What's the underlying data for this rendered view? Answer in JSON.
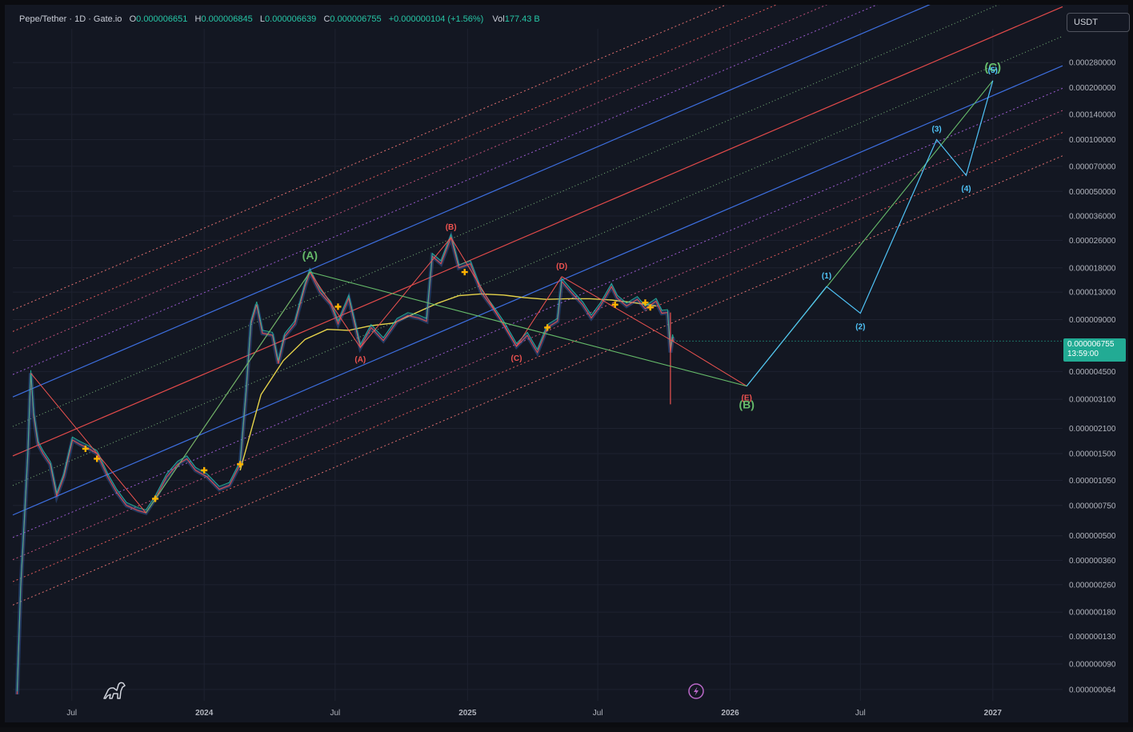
{
  "header": {
    "symbol": "Pepe/Tether · 1D · Gate.io",
    "open_key": "O",
    "open": "0.000006651",
    "high_key": "H",
    "high": "0.000006845",
    "low_key": "L",
    "low": "0.000006639",
    "close_key": "C",
    "close": "0.000006755",
    "change": "+0.000000104 (+1.56%)",
    "vol_key": "Vol",
    "vol": "177.43 B"
  },
  "currency_button": "USDT",
  "price_tag": {
    "price": "0.000006755",
    "countdown": "13:59:00"
  },
  "colors": {
    "background": "#131722",
    "grid": "#1e2230",
    "up": "#26c6a6",
    "down": "#ef5350",
    "channel_blue": "#3d6fe0",
    "channel_red": "#e34a4a",
    "wave_green": "#66bb6a",
    "wave_cyan": "#4fc3f7",
    "wave_red_label": "#ef5350",
    "ma_yellow": "#e6d34a"
  },
  "icons": {
    "logo": "dinosaur-icon",
    "alert": "lightning-icon"
  },
  "chart_data": {
    "type": "line",
    "title": "",
    "xlabel": "",
    "ylabel": "",
    "y_scale": "log",
    "ylim": [
      5.5e-08,
      0.00044
    ],
    "xlim": [
      "2023-04-10",
      "2027-04-08"
    ],
    "grid": true,
    "x_ticks": [
      {
        "date": "2023-07-01",
        "label": "Jul"
      },
      {
        "date": "2024-01-01",
        "label": "2024"
      },
      {
        "date": "2024-07-01",
        "label": "Jul"
      },
      {
        "date": "2025-01-01",
        "label": "2025"
      },
      {
        "date": "2025-07-01",
        "label": "Jul"
      },
      {
        "date": "2026-01-01",
        "label": "2026"
      },
      {
        "date": "2026-07-01",
        "label": "Jul"
      },
      {
        "date": "2027-01-01",
        "label": "2027"
      }
    ],
    "y_ticks": [
      {
        "value": 0.00028,
        "label": "0.000280000"
      },
      {
        "value": 0.0002,
        "label": "0.000200000"
      },
      {
        "value": 0.00014,
        "label": "0.000140000"
      },
      {
        "value": 0.0001,
        "label": "0.000100000"
      },
      {
        "value": 7e-05,
        "label": "0.000070000"
      },
      {
        "value": 5e-05,
        "label": "0.000050000"
      },
      {
        "value": 3.6e-05,
        "label": "0.000036000"
      },
      {
        "value": 2.6e-05,
        "label": "0.000026000"
      },
      {
        "value": 1.8e-05,
        "label": "0.000018000"
      },
      {
        "value": 1.3e-05,
        "label": "0.000013000"
      },
      {
        "value": 9e-06,
        "label": "0.000009000"
      },
      {
        "value": 4.5e-06,
        "label": "0.000004500"
      },
      {
        "value": 3.1e-06,
        "label": "0.000003100"
      },
      {
        "value": 2.1e-06,
        "label": "0.000002100"
      },
      {
        "value": 1.5e-06,
        "label": "0.000001500"
      },
      {
        "value": 1.05e-06,
        "label": "0.000001050"
      },
      {
        "value": 7.5e-07,
        "label": "0.000000750"
      },
      {
        "value": 5e-07,
        "label": "0.000000500"
      },
      {
        "value": 3.6e-07,
        "label": "0.000000360"
      },
      {
        "value": 2.6e-07,
        "label": "0.000000260"
      },
      {
        "value": 1.8e-07,
        "label": "0.000000180"
      },
      {
        "value": 1.3e-07,
        "label": "0.000000130"
      },
      {
        "value": 9e-08,
        "label": "0.000000090"
      },
      {
        "value": 6.4e-08,
        "label": "0.000000064"
      }
    ],
    "current_price": 6.755e-06,
    "price_path": [
      [
        "2023-04-16",
        6e-08
      ],
      [
        "2023-04-21",
        2.5e-07
      ],
      [
        "2023-04-26",
        6e-07
      ],
      [
        "2023-05-01",
        1.5e-06
      ],
      [
        "2023-05-05",
        4.4e-06
      ],
      [
        "2023-05-09",
        2.5e-06
      ],
      [
        "2023-05-15",
        1.7e-06
      ],
      [
        "2023-05-22",
        1.5e-06
      ],
      [
        "2023-06-01",
        1.3e-06
      ],
      [
        "2023-06-10",
        8.5e-07
      ],
      [
        "2023-06-20",
        1.1e-06
      ],
      [
        "2023-07-02",
        1.8e-06
      ],
      [
        "2023-07-12",
        1.7e-06
      ],
      [
        "2023-07-25",
        1.6e-06
      ],
      [
        "2023-08-05",
        1.5e-06
      ],
      [
        "2023-08-20",
        1.1e-06
      ],
      [
        "2023-09-01",
        9e-07
      ],
      [
        "2023-09-15",
        7.5e-07
      ],
      [
        "2023-10-01",
        7e-07
      ],
      [
        "2023-10-12",
        6.8e-07
      ],
      [
        "2023-10-25",
        8.2e-07
      ],
      [
        "2023-11-10",
        1.1e-06
      ],
      [
        "2023-11-25",
        1.3e-06
      ],
      [
        "2023-12-08",
        1.4e-06
      ],
      [
        "2023-12-20",
        1.2e-06
      ],
      [
        "2024-01-05",
        1.1e-06
      ],
      [
        "2024-01-22",
        9.3e-07
      ],
      [
        "2024-02-05",
        9.8e-07
      ],
      [
        "2024-02-20",
        1.3e-06
      ],
      [
        "2024-02-28",
        3.3e-06
      ],
      [
        "2024-03-06",
        8.5e-06
      ],
      [
        "2024-03-14",
        1.1e-05
      ],
      [
        "2024-03-22",
        7.5e-06
      ],
      [
        "2024-04-05",
        7.3e-06
      ],
      [
        "2024-04-13",
        5e-06
      ],
      [
        "2024-04-22",
        7.2e-06
      ],
      [
        "2024-05-06",
        8.5e-06
      ],
      [
        "2024-05-20",
        1.4e-05
      ],
      [
        "2024-05-27",
        1.7e-05
      ],
      [
        "2024-06-10",
        1.3e-05
      ],
      [
        "2024-06-25",
        1.1e-05
      ],
      [
        "2024-07-05",
        8.5e-06
      ],
      [
        "2024-07-20",
        1.2e-05
      ],
      [
        "2024-08-05",
        6.2e-06
      ],
      [
        "2024-08-20",
        8.1e-06
      ],
      [
        "2024-09-06",
        6.8e-06
      ],
      [
        "2024-09-25",
        8.8e-06
      ],
      [
        "2024-10-10",
        9.5e-06
      ],
      [
        "2024-10-25",
        9.2e-06
      ],
      [
        "2024-11-05",
        8.8e-06
      ],
      [
        "2024-11-13",
        2.1e-05
      ],
      [
        "2024-11-25",
        1.9e-05
      ],
      [
        "2024-12-09",
        2.7e-05
      ],
      [
        "2024-12-20",
        1.8e-05
      ],
      [
        "2025-01-05",
        1.9e-05
      ],
      [
        "2025-01-20",
        1.3e-05
      ],
      [
        "2025-02-05",
        1.05e-05
      ],
      [
        "2025-02-20",
        8.5e-06
      ],
      [
        "2025-03-10",
        6.3e-06
      ],
      [
        "2025-03-25",
        7.3e-06
      ],
      [
        "2025-04-08",
        5.8e-06
      ],
      [
        "2025-04-22",
        8.1e-06
      ],
      [
        "2025-05-06",
        8.8e-06
      ],
      [
        "2025-05-12",
        1.5e-05
      ],
      [
        "2025-05-25",
        1.3e-05
      ],
      [
        "2025-06-10",
        1.1e-05
      ],
      [
        "2025-06-22",
        9.2e-06
      ],
      [
        "2025-07-05",
        1.09e-05
      ],
      [
        "2025-07-20",
        1.4e-05
      ],
      [
        "2025-07-28",
        1.2e-05
      ],
      [
        "2025-08-10",
        1.08e-05
      ],
      [
        "2025-08-25",
        1.18e-05
      ],
      [
        "2025-09-05",
        1.04e-05
      ],
      [
        "2025-09-20",
        1.15e-05
      ],
      [
        "2025-09-28",
        9.8e-06
      ],
      [
        "2025-10-06",
        9.9e-06
      ],
      [
        "2025-10-10",
        5.8e-06
      ],
      [
        "2025-10-13",
        7.1e-06
      ],
      [
        "2025-10-14",
        6.755e-06
      ]
    ],
    "moving_average": [
      [
        "2024-02-20",
        1.2e-06
      ],
      [
        "2024-03-20",
        3.3e-06
      ],
      [
        "2024-04-20",
        5.2e-06
      ],
      [
        "2024-05-20",
        6.9e-06
      ],
      [
        "2024-06-20",
        7.9e-06
      ],
      [
        "2024-07-20",
        7.8e-06
      ],
      [
        "2024-08-20",
        8.3e-06
      ],
      [
        "2024-09-20",
        8.6e-06
      ],
      [
        "2024-10-20",
        9.8e-06
      ],
      [
        "2024-11-20",
        1.12e-05
      ],
      [
        "2024-12-20",
        1.24e-05
      ],
      [
        "2025-01-20",
        1.27e-05
      ],
      [
        "2025-02-20",
        1.25e-05
      ],
      [
        "2025-03-20",
        1.21e-05
      ],
      [
        "2025-04-20",
        1.18e-05
      ],
      [
        "2025-05-20",
        1.19e-05
      ],
      [
        "2025-06-20",
        1.19e-05
      ],
      [
        "2025-07-20",
        1.17e-05
      ],
      [
        "2025-08-20",
        1.13e-05
      ],
      [
        "2025-09-20",
        1.08e-05
      ]
    ],
    "zigzag_red": [
      [
        "2023-05-05",
        4.4e-06
      ],
      [
        "2023-10-12",
        6.8e-07
      ],
      [
        "2024-05-27",
        1.7e-05
      ],
      [
        "2024-08-05",
        6.2e-06
      ],
      [
        "2024-12-09",
        2.7e-05
      ],
      [
        "2025-03-10",
        6.3e-06
      ],
      [
        "2025-05-12",
        1.6e-05
      ],
      [
        "2025-10-20",
        6.5e-06
      ],
      [
        "2026-01-24",
        3.7e-06
      ]
    ],
    "waves_primary": [
      {
        "label": "(A)",
        "date": "2024-05-27",
        "value": 1.7e-05
      },
      {
        "label": "(B)",
        "date": "2026-01-24",
        "value": 3.7e-06
      },
      {
        "label": "(C)",
        "date": "2027-01-01",
        "value": 0.00022
      }
    ],
    "waves_intermediate": [
      {
        "label": "(A)",
        "date": "2024-08-05",
        "value": 6.2e-06
      },
      {
        "label": "(B)",
        "date": "2024-12-09",
        "value": 2.7e-05
      },
      {
        "label": "(C)",
        "date": "2025-03-10",
        "value": 6.3e-06
      },
      {
        "label": "(D)",
        "date": "2025-05-12",
        "value": 1.6e-05
      },
      {
        "label": "(E)",
        "date": "2026-01-24",
        "value": 3.7e-06
      }
    ],
    "waves_impulse": [
      {
        "label": "(1)",
        "date": "2026-05-15",
        "value": 1.4e-05
      },
      {
        "label": "(2)",
        "date": "2026-07-01",
        "value": 9.8e-06
      },
      {
        "label": "(3)",
        "date": "2026-10-15",
        "value": 0.0001
      },
      {
        "label": "(4)",
        "date": "2026-11-25",
        "value": 6.2e-05
      },
      {
        "label": "(5)",
        "date": "2027-01-01",
        "value": 0.00022
      }
    ],
    "channel": {
      "anchor_low": {
        "date": "2023-04-10",
        "value": 6.6e-07
      },
      "anchor_high": {
        "date": "2023-04-10",
        "value": 3.2e-06
      },
      "slope_per_year": 4.5,
      "extension_multiples": [
        1.35,
        1.8,
        2.4,
        3.2,
        0.74,
        0.55,
        0.41,
        0.3
      ]
    }
  }
}
